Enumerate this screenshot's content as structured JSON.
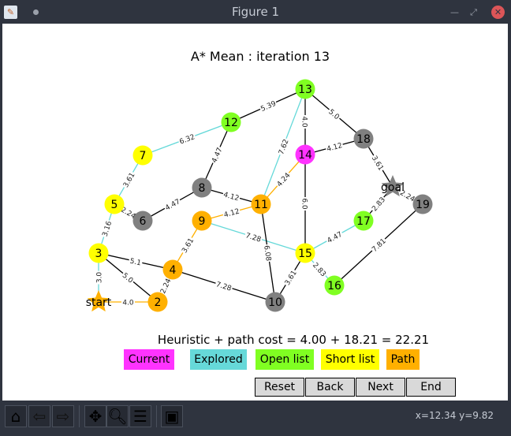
{
  "window": {
    "title": "Figure 1"
  },
  "plot": {
    "title": "A* Mean : iteration 13",
    "summary": "Heuristic + path cost = 4.00 + 18.21 = 22.21",
    "colors": {
      "current": "#ff33ff",
      "explored": "#66d9d9",
      "open": "#80ff22",
      "short": "#ffff00",
      "path": "#ffb000",
      "unvisited": "#808080",
      "edge": "#000000"
    },
    "nodes": [
      {
        "id": "13",
        "state": "open"
      },
      {
        "id": "12",
        "state": "open"
      },
      {
        "id": "18",
        "state": "unvisited"
      },
      {
        "id": "7",
        "state": "short"
      },
      {
        "id": "14",
        "state": "current"
      },
      {
        "id": "8",
        "state": "unvisited"
      },
      {
        "id": "goal",
        "state": "unvisited",
        "shape": "star"
      },
      {
        "id": "11",
        "state": "path"
      },
      {
        "id": "19",
        "state": "unvisited"
      },
      {
        "id": "5",
        "state": "short"
      },
      {
        "id": "6",
        "state": "unvisited"
      },
      {
        "id": "9",
        "state": "path"
      },
      {
        "id": "17",
        "state": "open"
      },
      {
        "id": "3",
        "state": "short"
      },
      {
        "id": "15",
        "state": "short"
      },
      {
        "id": "4",
        "state": "path"
      },
      {
        "id": "16",
        "state": "open"
      },
      {
        "id": "start",
        "state": "path",
        "shape": "star"
      },
      {
        "id": "2",
        "state": "path"
      },
      {
        "id": "10",
        "state": "unvisited"
      }
    ],
    "edges": [
      {
        "a": "start",
        "b": "2",
        "w": "4.0",
        "state": "path"
      },
      {
        "a": "start",
        "b": "3",
        "w": "3.0",
        "state": "explored"
      },
      {
        "a": "3",
        "b": "5",
        "w": "3.16",
        "state": "explored"
      },
      {
        "a": "5",
        "b": "7",
        "w": "3.61",
        "state": "explored"
      },
      {
        "a": "5",
        "b": "6",
        "w": "2.24",
        "state": "edge"
      },
      {
        "a": "7",
        "b": "12",
        "w": "6.32",
        "state": "explored"
      },
      {
        "a": "12",
        "b": "8",
        "w": "4.47",
        "state": "edge"
      },
      {
        "a": "12",
        "b": "13",
        "w": "5.39",
        "state": "edge"
      },
      {
        "a": "6",
        "b": "8",
        "w": "4.47",
        "state": "edge"
      },
      {
        "a": "8",
        "b": "11",
        "w": "4.12",
        "state": "edge"
      },
      {
        "a": "9",
        "b": "11",
        "w": "4.12",
        "state": "path"
      },
      {
        "a": "9",
        "b": "15",
        "w": "7.28",
        "state": "explored"
      },
      {
        "a": "4",
        "b": "9",
        "w": "3.61",
        "state": "path"
      },
      {
        "a": "2",
        "b": "4",
        "w": "2.24",
        "state": "path"
      },
      {
        "a": "3",
        "b": "4",
        "w": "5.1",
        "state": "edge"
      },
      {
        "a": "3",
        "b": "2",
        "w": "5.0",
        "state": "edge"
      },
      {
        "a": "4",
        "b": "10",
        "w": "7.28",
        "state": "edge"
      },
      {
        "a": "11",
        "b": "10",
        "w": "6.08",
        "state": "edge"
      },
      {
        "a": "11",
        "b": "13",
        "w": "7.62",
        "state": "explored"
      },
      {
        "a": "11",
        "b": "14",
        "w": "4.24",
        "state": "path"
      },
      {
        "a": "13",
        "b": "14",
        "w": "4.0",
        "state": "edge"
      },
      {
        "a": "13",
        "b": "18",
        "w": "5.0",
        "state": "edge"
      },
      {
        "a": "14",
        "b": "18",
        "w": "4.12",
        "state": "edge"
      },
      {
        "a": "14",
        "b": "15",
        "w": "6.0",
        "state": "edge"
      },
      {
        "a": "18",
        "b": "goal",
        "w": "3.61",
        "state": "edge"
      },
      {
        "a": "goal",
        "b": "19",
        "w": "2.24",
        "state": "edge"
      },
      {
        "a": "goal",
        "b": "17",
        "w": "2.83",
        "state": "edge"
      },
      {
        "a": "15",
        "b": "17",
        "w": "4.47",
        "state": "explored"
      },
      {
        "a": "15",
        "b": "16",
        "w": "2.83",
        "state": "explored"
      },
      {
        "a": "15",
        "b": "10",
        "w": "3.61",
        "state": "edge"
      },
      {
        "a": "16",
        "b": "19",
        "w": "7.81",
        "state": "edge"
      }
    ]
  },
  "legend": {
    "current": "Current",
    "explored": "Explored",
    "open": "Open list",
    "short": "Short list",
    "path": "Path"
  },
  "buttons": {
    "reset": "Reset",
    "back": "Back",
    "next": "Next",
    "end": "End"
  },
  "toolbar": {
    "coords": "x=12.34 y=9.82",
    "icons": [
      "home-icon",
      "back-arrow-icon",
      "forward-arrow-icon",
      "pan-icon",
      "zoom-icon",
      "configure-subplots-icon",
      "save-icon"
    ]
  }
}
